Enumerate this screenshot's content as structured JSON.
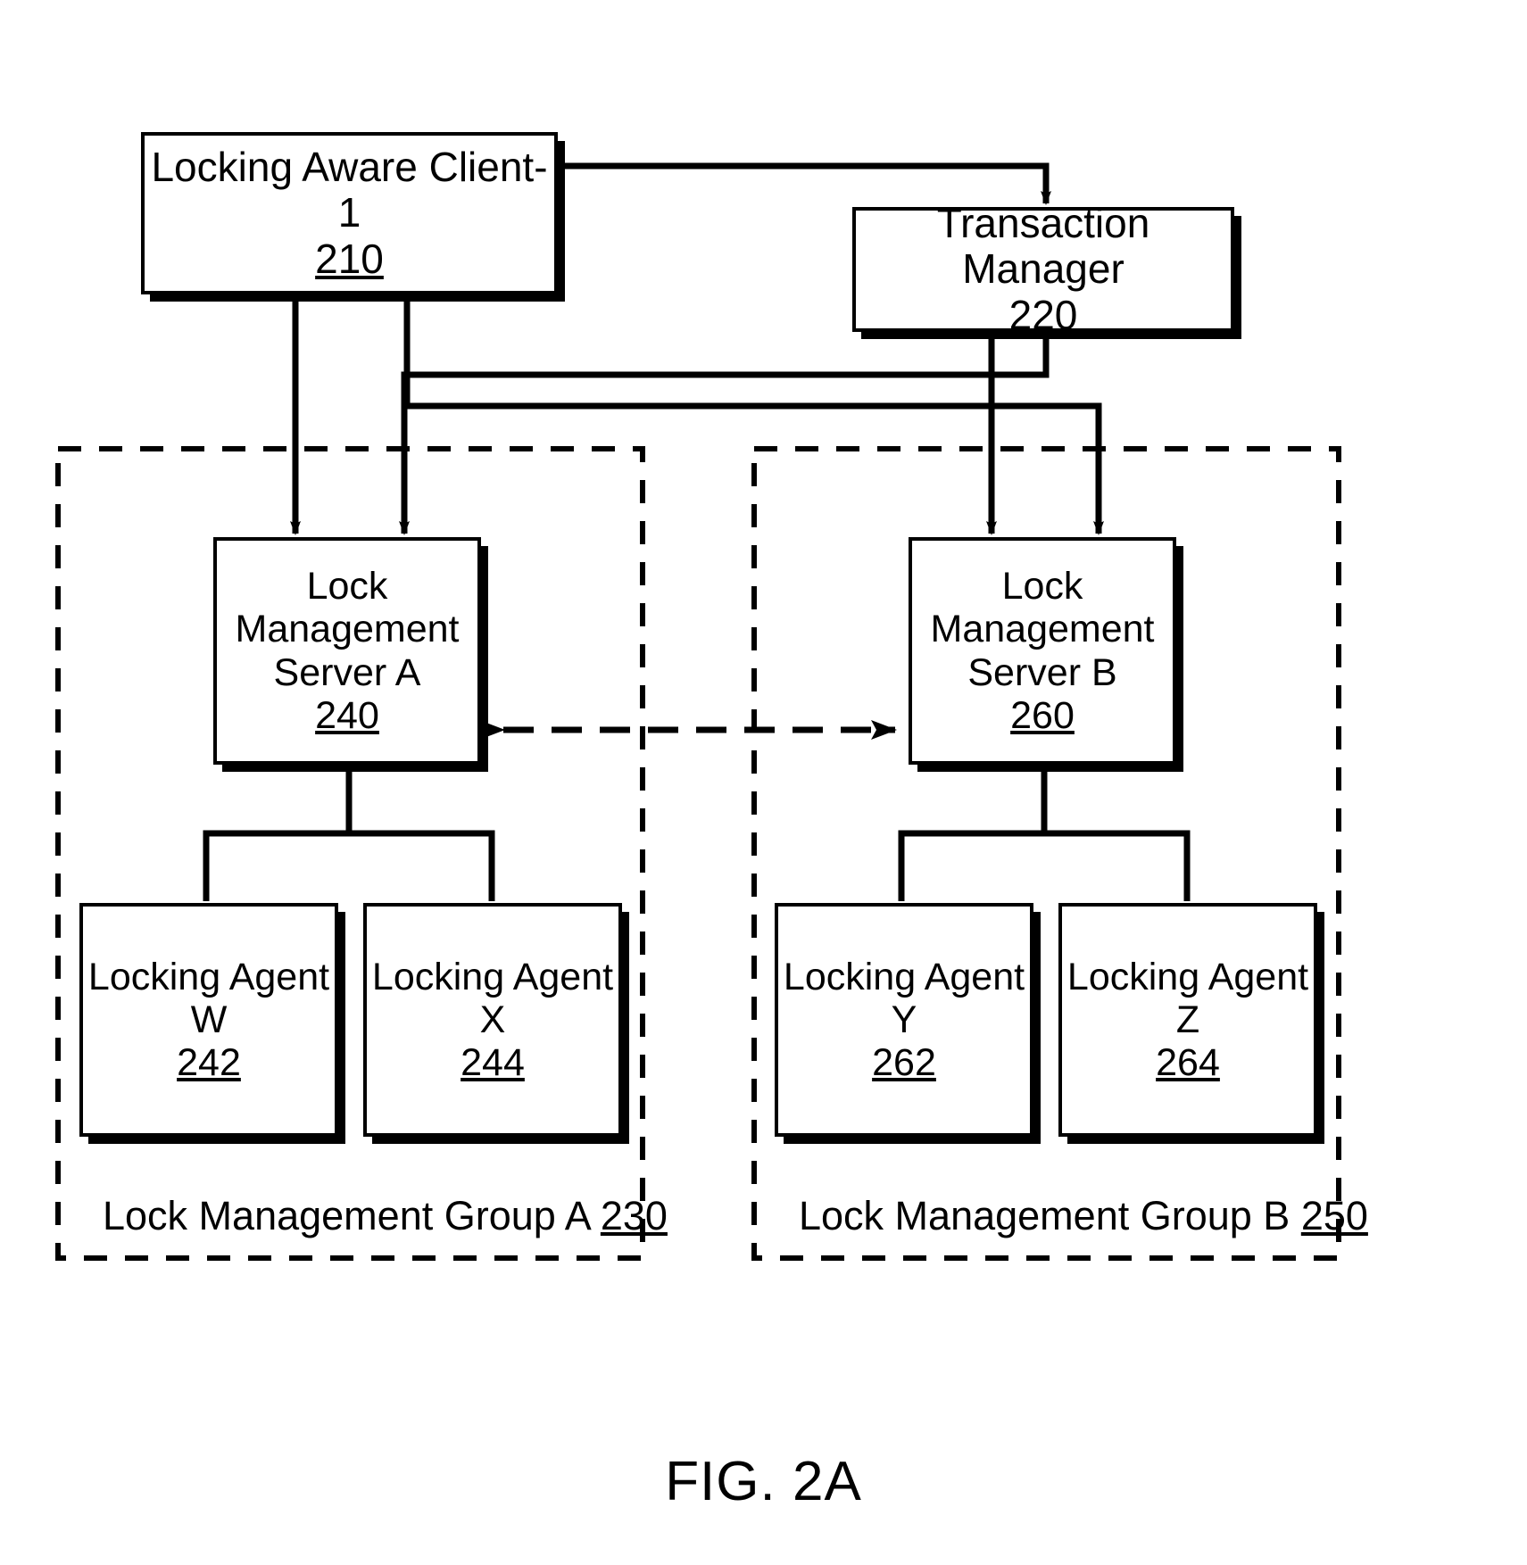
{
  "figure": {
    "caption": "FIG. 2A",
    "background_color": "#ffffff",
    "line_color": "#000000"
  },
  "nodes": {
    "client": {
      "title": "Locking Aware Client-1",
      "ref": "210",
      "name": "locking-aware-client-1-box"
    },
    "transaction_manager": {
      "title": "Transaction Manager",
      "ref": "220",
      "name": "transaction-manager-box"
    },
    "server_a": {
      "title": "Lock\nManagement\nServer A",
      "ref": "240",
      "name": "lock-management-server-a-box"
    },
    "server_b": {
      "title": "Lock\nManagement\nServer B",
      "ref": "260",
      "name": "lock-management-server-b-box"
    },
    "agent_w": {
      "title": "Locking Agent\nW",
      "ref": "242",
      "name": "locking-agent-w-box"
    },
    "agent_x": {
      "title": "Locking Agent\nX",
      "ref": "244",
      "name": "locking-agent-x-box"
    },
    "agent_y": {
      "title": "Locking Agent\nY",
      "ref": "262",
      "name": "locking-agent-y-box"
    },
    "agent_z": {
      "title": "Locking Agent\nZ",
      "ref": "264",
      "name": "locking-agent-z-box"
    }
  },
  "groups": {
    "group_a": {
      "label": "Lock Management Group A ",
      "ref": "230"
    },
    "group_b": {
      "label": "Lock Management Group B ",
      "ref": "250"
    }
  },
  "connections": [
    {
      "from": "client",
      "to": "transaction_manager",
      "style": "solid",
      "arrow": "single"
    },
    {
      "from": "client",
      "to": "server_a",
      "style": "solid",
      "arrow": "single"
    },
    {
      "from": "client",
      "to": "server_b",
      "style": "solid",
      "arrow": "single"
    },
    {
      "from": "transaction_manager",
      "to": "server_a",
      "style": "solid",
      "arrow": "single"
    },
    {
      "from": "transaction_manager",
      "to": "server_b",
      "style": "solid",
      "arrow": "single"
    },
    {
      "from": "server_a",
      "to": "server_b",
      "style": "dashed",
      "arrow": "double"
    },
    {
      "from": "server_a",
      "to": "agent_w",
      "style": "solid",
      "arrow": "none"
    },
    {
      "from": "server_a",
      "to": "agent_x",
      "style": "solid",
      "arrow": "none"
    },
    {
      "from": "server_b",
      "to": "agent_y",
      "style": "solid",
      "arrow": "none"
    },
    {
      "from": "server_b",
      "to": "agent_z",
      "style": "solid",
      "arrow": "none"
    }
  ]
}
